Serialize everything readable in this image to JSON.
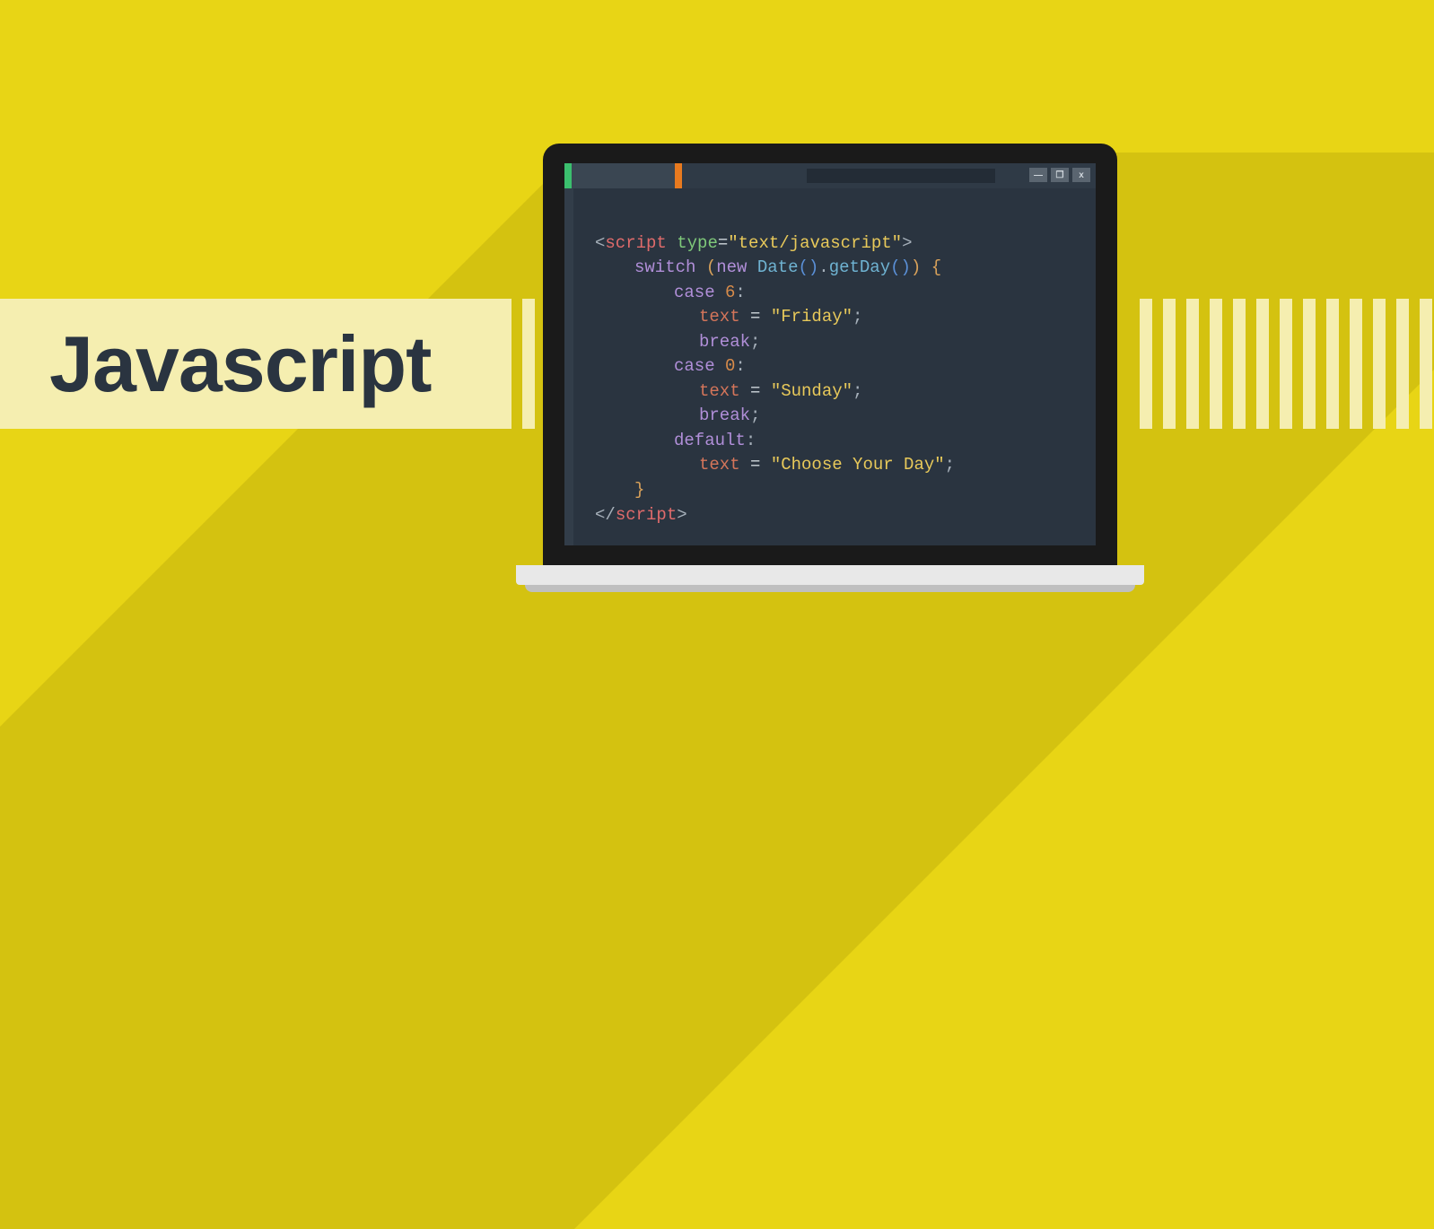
{
  "title": "Javascript",
  "window_controls": {
    "minimize": "—",
    "maximize": "❐",
    "close": "x"
  },
  "code": {
    "scriptOpen": {
      "tag": "script",
      "attrName": "type",
      "attrValue": "\"text/javascript\""
    },
    "switchKw": "switch",
    "newKw": "new",
    "dateCls": "Date",
    "getDayFn": "getDay",
    "case1": {
      "kw": "case",
      "num": "6"
    },
    "line_friday": {
      "var": "text",
      "eq": "=",
      "str": "\"Friday\""
    },
    "break": "break",
    "case2": {
      "kw": "case",
      "num": "0"
    },
    "line_sunday": {
      "var": "text",
      "eq": "=",
      "str": "\"Sunday\""
    },
    "defaultKw": "default",
    "line_choose": {
      "var": "text",
      "eq": "=",
      "str": "\"Choose Your Day\""
    },
    "scriptClose": "script"
  }
}
